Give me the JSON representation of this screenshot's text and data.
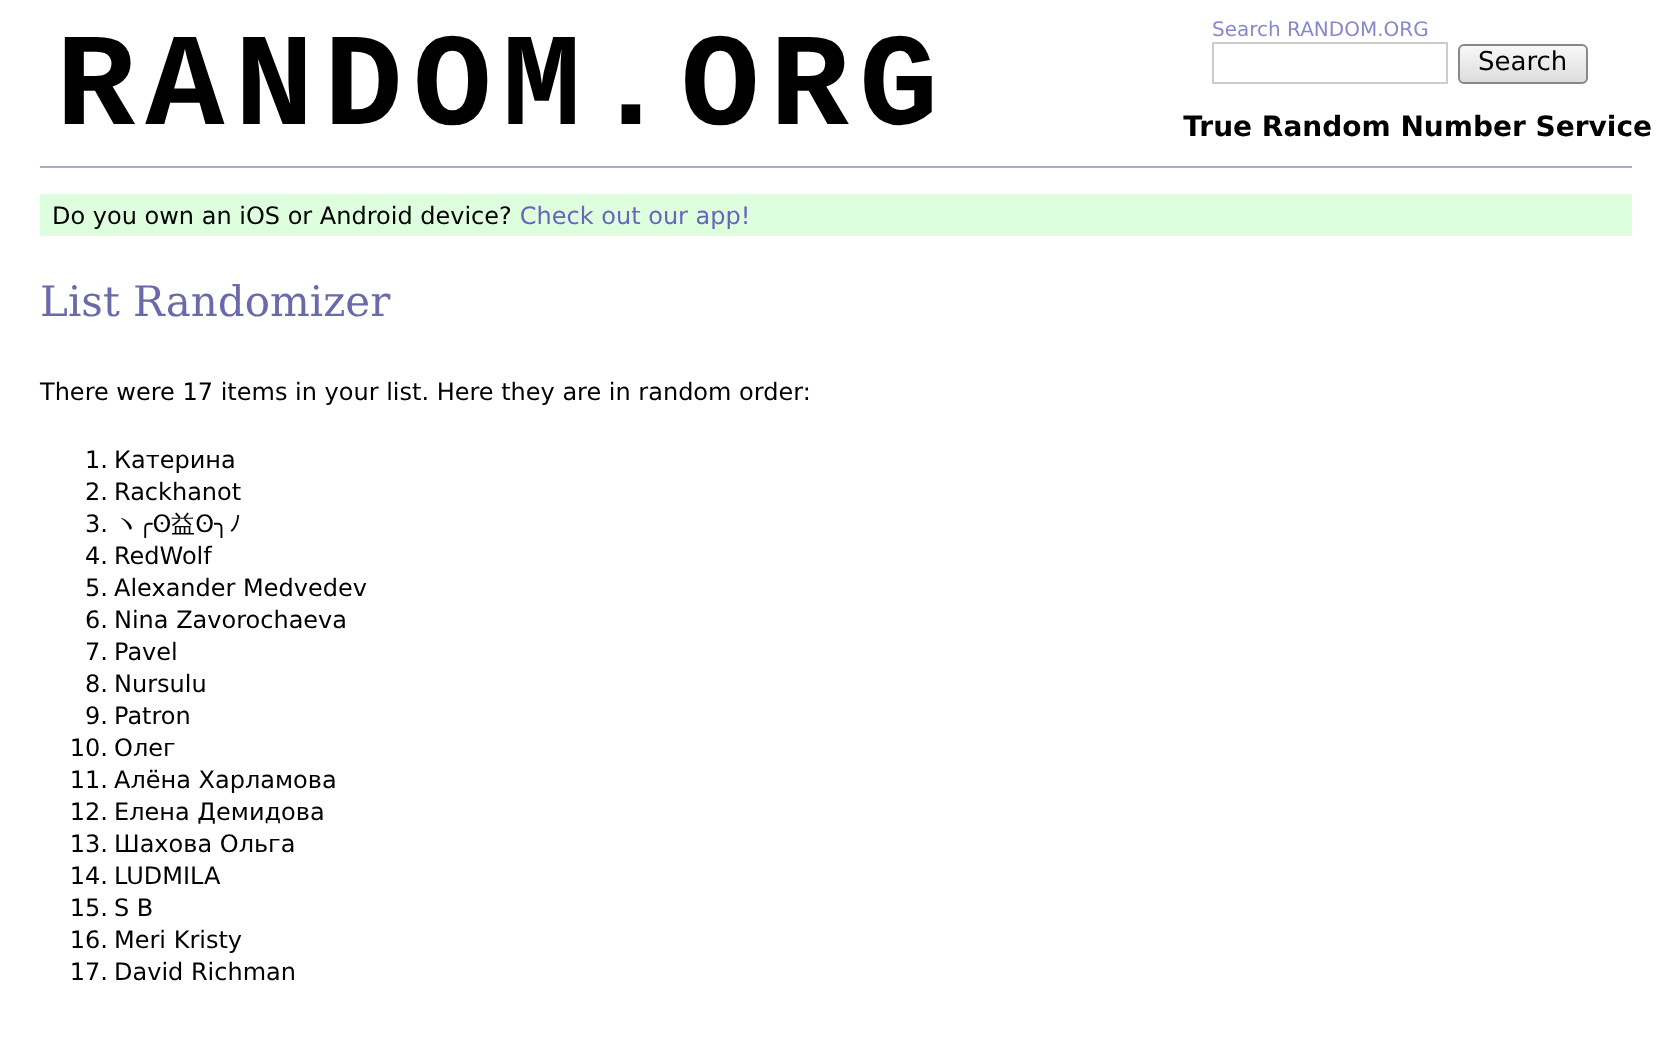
{
  "header": {
    "logo": "RANDOM.ORG",
    "search": {
      "label": "Search RANDOM.ORG",
      "button": "Search"
    },
    "tagline": "True Random Number Service"
  },
  "banner": {
    "text": "Do you own an iOS or Android device?",
    "link": "Check out our app!"
  },
  "title": "List Randomizer",
  "intro": "There were 17 items in your list. Here they are in random order:",
  "items": [
    {
      "number": "1.",
      "text": "Катерина"
    },
    {
      "number": "2.",
      "text": "Rackhanot"
    },
    {
      "number": "3.",
      "text": "ヽ╭ʘ益ʘ╮ﾉ"
    },
    {
      "number": "4.",
      "text": "RedWolf"
    },
    {
      "number": "5.",
      "text": "Alexander Medvedev"
    },
    {
      "number": "6.",
      "text": "Nina Zavorochaeva"
    },
    {
      "number": "7.",
      "text": "Pavel"
    },
    {
      "number": "8.",
      "text": "Nursulu"
    },
    {
      "number": "9.",
      "text": "Patron"
    },
    {
      "number": "10.",
      "text": "Олег"
    },
    {
      "number": "11.",
      "text": "Алёна Харламова"
    },
    {
      "number": "12.",
      "text": "Елена Демидова"
    },
    {
      "number": "13.",
      "text": "Шахова Ольга"
    },
    {
      "number": "14.",
      "text": "LUDMILA"
    },
    {
      "number": "15.",
      "text": "S B"
    },
    {
      "number": "16.",
      "text": "Meri Kristy"
    },
    {
      "number": "17.",
      "text": "David Richman"
    }
  ]
}
